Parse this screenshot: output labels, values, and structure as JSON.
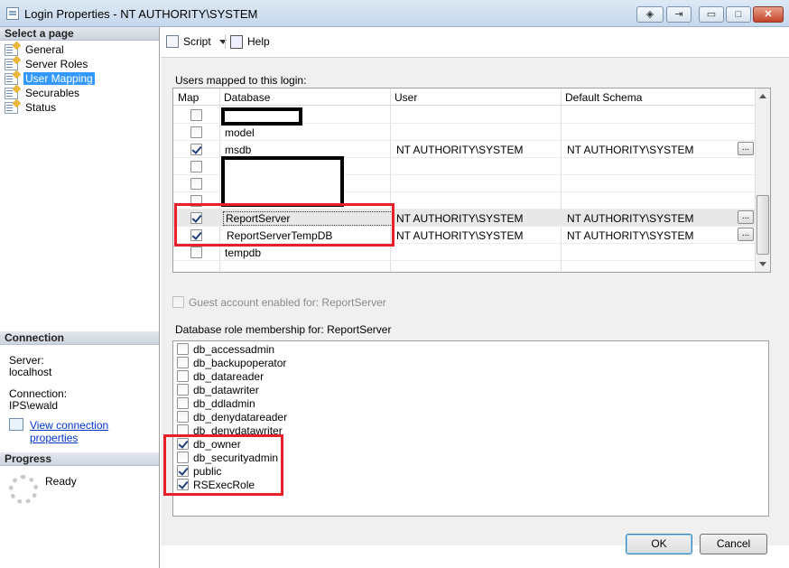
{
  "window": {
    "title": "Login Properties - NT AUTHORITY\\SYSTEM",
    "help_glyph": "◈",
    "restore_glyph": "⇥",
    "minimize_glyph": "▭",
    "maximize_glyph": "□",
    "close_glyph": "✕"
  },
  "left": {
    "select_page": "Select a page",
    "pages": [
      {
        "label": "General"
      },
      {
        "label": "Server Roles"
      },
      {
        "label": "User Mapping",
        "selected": true
      },
      {
        "label": "Securables"
      },
      {
        "label": "Status"
      }
    ],
    "connection_header": "Connection",
    "server_label": "Server:",
    "server_value": "localhost",
    "connection_label": "Connection:",
    "connection_value": "IPS\\ewald",
    "view_props_link": "View connection properties",
    "progress_header": "Progress",
    "progress_status": "Ready"
  },
  "toolbar": {
    "script_label": "Script",
    "help_label": "Help"
  },
  "mapping": {
    "label": "Users mapped to this login:",
    "headers": [
      "Map",
      "Database",
      "User",
      "Default Schema"
    ],
    "rows": [
      {
        "checked": false,
        "database": "",
        "user": "",
        "schema": ""
      },
      {
        "checked": false,
        "database": "model",
        "user": "",
        "schema": ""
      },
      {
        "checked": true,
        "database": "msdb",
        "user": "NT AUTHORITY\\SYSTEM",
        "schema": "NT AUTHORITY\\SYSTEM"
      },
      {
        "checked": false,
        "database": "",
        "user": "",
        "schema": ""
      },
      {
        "checked": false,
        "database": "",
        "user": "",
        "schema": ""
      },
      {
        "checked": false,
        "database": "",
        "user": "",
        "schema": ""
      },
      {
        "checked": true,
        "database": "ReportServer",
        "user": "NT AUTHORITY\\SYSTEM",
        "schema": "NT AUTHORITY\\SYSTEM"
      },
      {
        "checked": true,
        "database": "ReportServerTempDB",
        "user": "NT AUTHORITY\\SYSTEM",
        "schema": "NT AUTHORITY\\SYSTEM"
      },
      {
        "checked": false,
        "database": "tempdb",
        "user": "",
        "schema": ""
      }
    ],
    "ellipsis": "..."
  },
  "guest": {
    "label": "Guest account enabled for: ReportServer",
    "checked": false
  },
  "roles": {
    "label": "Database role membership for: ReportServer",
    "items": [
      {
        "name": "db_accessadmin",
        "checked": false
      },
      {
        "name": "db_backupoperator",
        "checked": false
      },
      {
        "name": "db_datareader",
        "checked": false
      },
      {
        "name": "db_datawriter",
        "checked": false
      },
      {
        "name": "db_ddladmin",
        "checked": false
      },
      {
        "name": "db_denydatareader",
        "checked": false
      },
      {
        "name": "db_denydatawriter",
        "checked": false
      },
      {
        "name": "db_owner",
        "checked": true
      },
      {
        "name": "db_securityadmin",
        "checked": false
      },
      {
        "name": "public",
        "checked": true
      },
      {
        "name": "RSExecRole",
        "checked": true
      }
    ]
  },
  "buttons": {
    "ok": "OK",
    "cancel": "Cancel"
  },
  "colors": {
    "highlight": "#e8202a",
    "selection": "#3399ff",
    "link": "#0033cc"
  }
}
